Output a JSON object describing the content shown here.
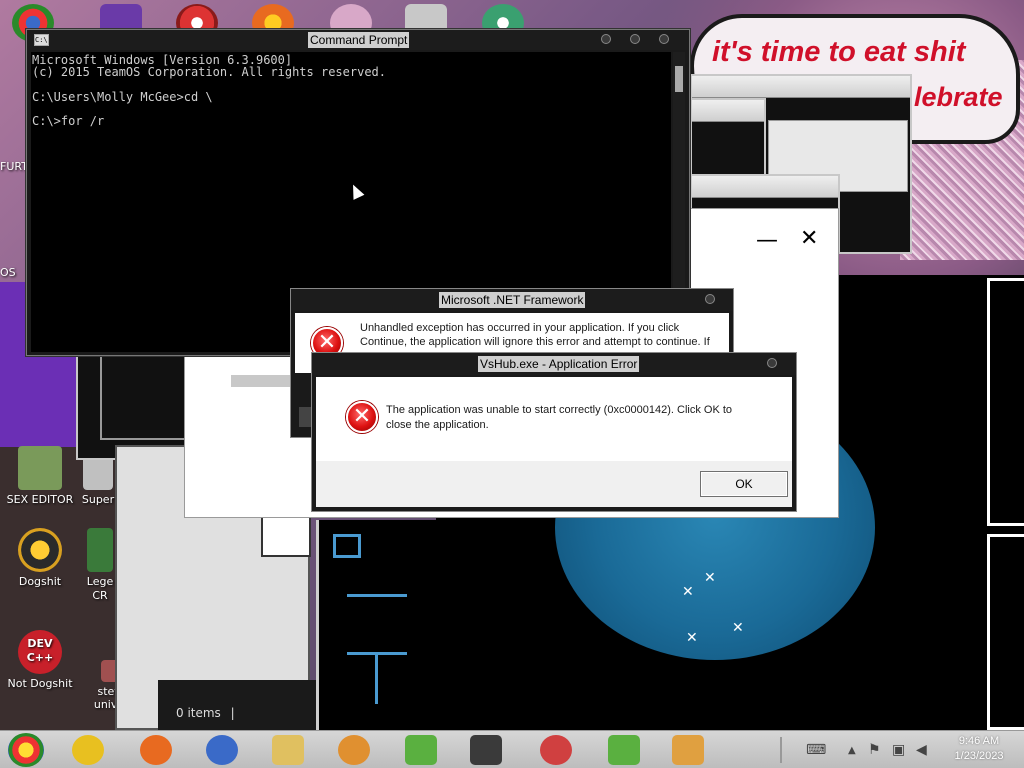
{
  "desktop": {
    "icons": [
      {
        "label": "SEX EDITOR",
        "color": "#7a9a5a"
      },
      {
        "label": "Super",
        "color": "#c0c0c0"
      },
      {
        "label": "Dogshit",
        "color": "#d8a020"
      },
      {
        "label": "Lege",
        "color": "#3a7a3a"
      },
      {
        "label": "CR",
        "color": "#3a7a3a"
      },
      {
        "label": "Not Dogshit",
        "color": "#c8202a"
      },
      {
        "label": "steven",
        "color": "#a05050"
      },
      {
        "label": "univer...",
        "color": "#a05050"
      },
      {
        "label": "DEV",
        "color": "#c8202a"
      },
      {
        "label": "C++",
        "color": "#c8202a"
      },
      {
        "label": "FURT",
        "color": "#c06060"
      },
      {
        "label": "OS",
        "color": "#4a4a9a"
      }
    ],
    "bubble_line1": "it's time to eat shit",
    "bubble_line2": "lebrate"
  },
  "cmd": {
    "title": "Command Prompt",
    "sys_icon": "C:\\",
    "lines": [
      "Microsoft Windows [Version 6.3.9600]",
      "(c) 2015 TeamOS Corporation. All rights reserved.",
      "",
      "C:\\Users\\Molly McGee>cd \\",
      "",
      "C:\\>for /r"
    ]
  },
  "dotnet": {
    "title": "Microsoft .NET Framework",
    "message_line1": "Unhandled exception has occurred in your application. If you click",
    "message_line2": "Continue, the application will ignore this error and attempt to continue. If"
  },
  "apperror": {
    "title": "VsHub.exe - Application Error",
    "message_line1": "The application was unable to start correctly (0xc0000142). Click OK to",
    "message_line2": "close the application.",
    "ok_label": "OK"
  },
  "behind_window": {
    "minimize_glyph": "—",
    "close_glyph": "✕",
    "items_count": "0 items",
    "cursor_bar": "|"
  },
  "taskbar": {
    "apps": [
      {
        "name": "chrome-icon",
        "color": "#e8c020"
      },
      {
        "name": "firefox-icon",
        "color": "#e86a20"
      },
      {
        "name": "obama-logo-icon",
        "color": "#3a6ac8"
      },
      {
        "name": "file-explorer-icon",
        "color": "#e0c060"
      },
      {
        "name": "keyhole-icon",
        "color": "#e09030"
      },
      {
        "name": "android-folder-icon",
        "color": "#5ab040"
      },
      {
        "name": "cmd-icon",
        "color": "#3a3a3a"
      },
      {
        "name": "bird-icon",
        "color": "#d04040"
      },
      {
        "name": "android-icon",
        "color": "#5ab040"
      },
      {
        "name": "notepad-icon",
        "color": "#e0a040"
      }
    ],
    "clock_time": "9:46 AM",
    "clock_date": "1/23/2023"
  }
}
